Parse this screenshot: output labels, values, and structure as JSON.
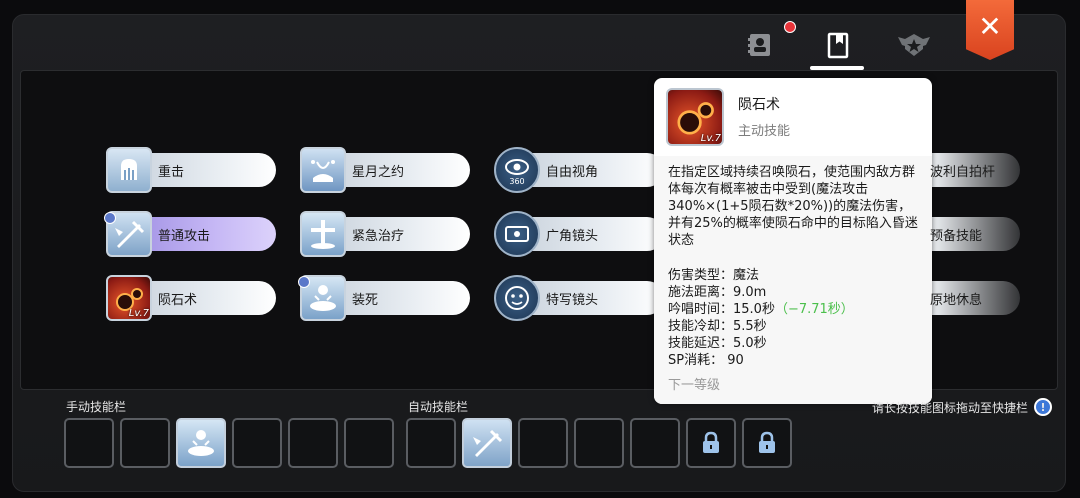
{
  "header": {
    "tabs": [
      {
        "icon": "contact-book-icon",
        "active": false,
        "notification": true
      },
      {
        "icon": "skill-book-icon",
        "active": true,
        "notification": false
      },
      {
        "icon": "emblem-icon",
        "active": false,
        "notification": false
      }
    ],
    "close_icon": "close-icon"
  },
  "skills": [
    {
      "label": "重击",
      "icon": "heavy-strike-icon"
    },
    {
      "label": "星月之约",
      "icon": "star-moon-pact-icon"
    },
    {
      "label": "自由视角",
      "icon": "free-view-icon",
      "badge": "360"
    },
    {
      "label": "波利自拍杆",
      "icon": "poring-selfie-stick-icon"
    },
    {
      "label": "普通攻击",
      "icon": "normal-attack-icon",
      "selected": true
    },
    {
      "label": "紧急治疗",
      "icon": "emergency-heal-icon"
    },
    {
      "label": "广角镜头",
      "icon": "wide-angle-icon"
    },
    {
      "label": "预备技能",
      "icon": "reserve-skill-icon"
    },
    {
      "label": "陨石术",
      "icon": "meteor-icon",
      "level": "Lv.7"
    },
    {
      "label": "装死",
      "icon": "play-dead-icon"
    },
    {
      "label": "特写镜头",
      "icon": "close-up-icon"
    },
    {
      "label": "原地休息",
      "icon": "rest-icon"
    }
  ],
  "tooltip": {
    "name": "陨石术",
    "type": "主动技能",
    "level": "Lv.7",
    "description": "在指定区域持续召唤陨石，使范围内敌方群体每次有概率被击中受到(魔法攻击340%×(1+5陨石数*20%))的魔法伤害，并有25%的概率使陨石命中的目标陷入昏迷状态",
    "stats": [
      {
        "label": "伤害类型：魔法",
        "extra": ""
      },
      {
        "label": "施法距离：9.0m",
        "extra": ""
      },
      {
        "label": "吟唱时间：15.0秒",
        "extra": "（−7.71秒）"
      },
      {
        "label": "技能冷却：5.5秒",
        "extra": ""
      },
      {
        "label": "技能延迟：5.0秒",
        "extra": ""
      },
      {
        "label": "SP消耗： 90",
        "extra": ""
      }
    ],
    "next_level": "下一等级"
  },
  "skill_bar": {
    "manual_label": "手动技能栏",
    "auto_label": "自动技能栏",
    "hint": "请长按技能图标拖动至快捷栏",
    "hint_icon": "info-icon",
    "manual_slots": [
      "",
      "",
      "play-dead-icon",
      "",
      "",
      ""
    ],
    "auto_slots": [
      "",
      "normal-attack-icon",
      "",
      "",
      "",
      "lock-icon",
      "lock-icon"
    ]
  },
  "colors": {
    "accent": "#e8533a",
    "selected_pill": "#b9a8f0",
    "cooldown_reduction": "#4bbf4b"
  }
}
